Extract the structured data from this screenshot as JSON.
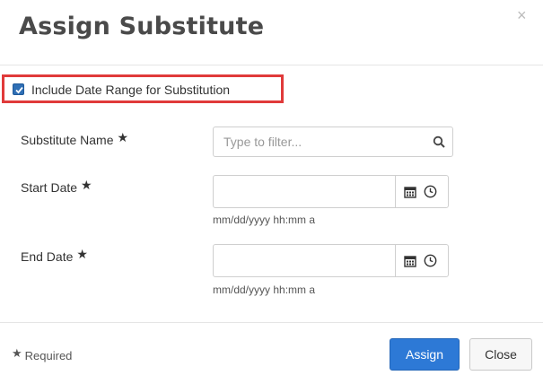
{
  "dialog": {
    "title": "Assign Substitute",
    "close_glyph": "×"
  },
  "include_range": {
    "label": "Include Date Range for Substitution",
    "checked": true
  },
  "fields": {
    "substitute": {
      "label": "Substitute Name",
      "required_marker": "★",
      "placeholder": "Type to filter...",
      "icon": "search-icon"
    },
    "start_date": {
      "label": "Start Date",
      "required_marker": "★",
      "value": "",
      "hint": "mm/dd/yyyy hh:mm a"
    },
    "end_date": {
      "label": "End Date",
      "required_marker": "★",
      "value": "",
      "hint": "mm/dd/yyyy hh:mm a"
    }
  },
  "footer": {
    "required_marker": "★",
    "required_label": "Required",
    "assign_label": "Assign",
    "close_label": "Close"
  },
  "colors": {
    "primary": "#2d79d6",
    "highlight": "#e03a3a",
    "checkbox": "#2f6fb5"
  }
}
